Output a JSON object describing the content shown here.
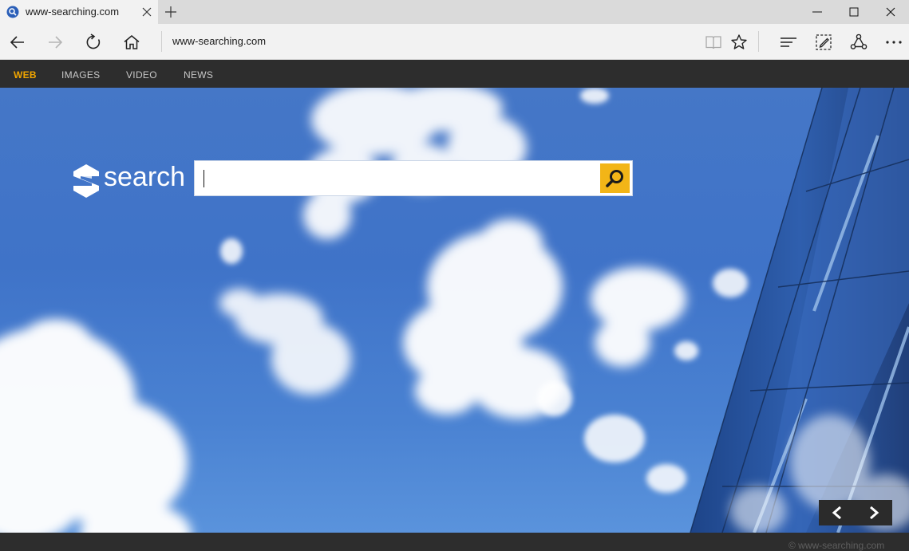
{
  "browser": {
    "tab": {
      "title": "www-searching.com",
      "favicon": "search-globe-icon"
    },
    "address": "www-searching.com",
    "toolbar_icons": [
      "back-icon",
      "forward-icon",
      "refresh-icon",
      "home-icon",
      "reading-view-icon",
      "favorite-star-icon",
      "hub-icon",
      "web-note-icon",
      "share-icon",
      "more-icon"
    ]
  },
  "site": {
    "nav": [
      {
        "label": "WEB",
        "active": true
      },
      {
        "label": "IMAGES",
        "active": false
      },
      {
        "label": "VIDEO",
        "active": false
      },
      {
        "label": "NEWS",
        "active": false
      }
    ],
    "logo_text": "search",
    "search": {
      "value": "",
      "placeholder": ""
    },
    "footer": "© www-searching.com"
  },
  "colors": {
    "accent": "#f2b517",
    "nav_active": "#f0a500",
    "nav_bg": "#2d2d2d",
    "sky": "#4577c7"
  }
}
